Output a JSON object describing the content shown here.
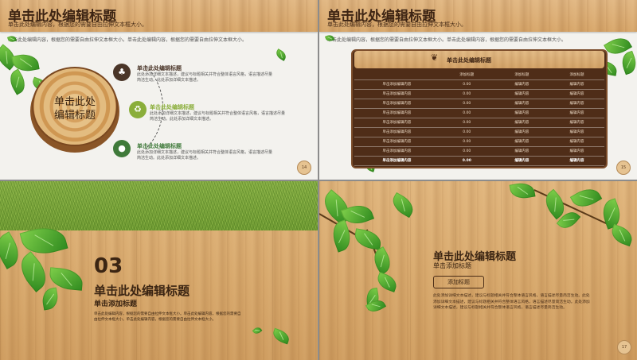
{
  "slide1": {
    "title": "单击此处编辑标题",
    "subtitle": "单击此处编辑内容，根据您的需要自由拉伸文本框大小。",
    "body_line": "单击此处编辑内容，根据您的需要自由拉伸文本框大小。单击此处编辑内容，根据您的需要自由拉伸文本框大小。",
    "stump_text": [
      "单击此处",
      "编辑标题"
    ],
    "items": [
      {
        "title": "单击此处编辑标题",
        "text": "此处添加详细文本描述，建议与标题相关并符合整体语言风格，语言描述尽量简洁生动。此处添加详细文本描述。",
        "icon": "tree-icon",
        "color": "#4a3528"
      },
      {
        "title": "单击此处编辑标题",
        "text": "此处添加详细文本描述，建议与标题相关并符合整体语言风格，语言描述尽量简洁生动。此处添加详细文本描述。",
        "icon": "recycle-icon",
        "color": "#8aae3a"
      },
      {
        "title": "单击此处编辑标题",
        "text": "此处添加详细文本描述，建议与标题相关并符合整体语言风格，语言描述尽量简洁生动。此处添加详细文本描述。",
        "icon": "bulb-icon",
        "color": "#3f7a3a"
      }
    ],
    "page": "14"
  },
  "slide2": {
    "title": "单击此处编辑标题",
    "subtitle": "单击此处编辑内容，根据您的需要自由拉伸文本框大小。",
    "body_line": "单击此处编辑内容，根据您的需要自由拉伸文本框大小。单击此处编辑内容，根据您的需要自由拉伸文本框大小。",
    "board_title": "单击此处编辑标题",
    "header": [
      "",
      "添加标题",
      "添加标题",
      "添加标题"
    ],
    "rows": [
      [
        "单击添加编辑内容",
        "0.00",
        "编辑内容",
        "编辑内容"
      ],
      [
        "单击添加编辑内容",
        "0.00",
        "编辑内容",
        "编辑内容"
      ],
      [
        "单击添加编辑内容",
        "0.00",
        "编辑内容",
        "编辑内容"
      ],
      [
        "单击添加编辑内容",
        "0.00",
        "编辑内容",
        "编辑内容"
      ],
      [
        "单击添加编辑内容",
        "0.00",
        "编辑内容",
        "编辑内容"
      ],
      [
        "单击添加编辑内容",
        "0.00",
        "编辑内容",
        "编辑内容"
      ],
      [
        "单击添加编辑内容",
        "0.00",
        "编辑内容",
        "编辑内容"
      ],
      [
        "单击添加编辑内容",
        "0.00",
        "编辑内容",
        "编辑内容"
      ],
      [
        "单击添加编辑内容",
        "0.00",
        "编辑内容",
        "编辑内容"
      ]
    ],
    "page": "15"
  },
  "slide3": {
    "number": "03",
    "title": "单击此处编辑标题",
    "subtitle": "单击添加标题",
    "body": "单击此处编辑内容，根据您的需要自由拉伸文本框大小。单击此处编辑内容，根据您的需要自由拉伸文本框大小。单击此处编辑内容，根据您的需要自由拉伸文本框大小。"
  },
  "slide4": {
    "title": "单击此处编辑标题",
    "subtitle": "单击添加标题",
    "button": "添加标题",
    "body": "此处添加详细文本描述，建议与标题相关并符合整体语言风格，语言描述尽量简洁生动。此处添加详细文本描述，建议与标题相关并符合整体语言风格，语言描述尽量简洁生动。此处添加详细文本描述，建议与标题相关并符合整体语言风格，语言描述尽量简洁生动。",
    "page": "17"
  }
}
